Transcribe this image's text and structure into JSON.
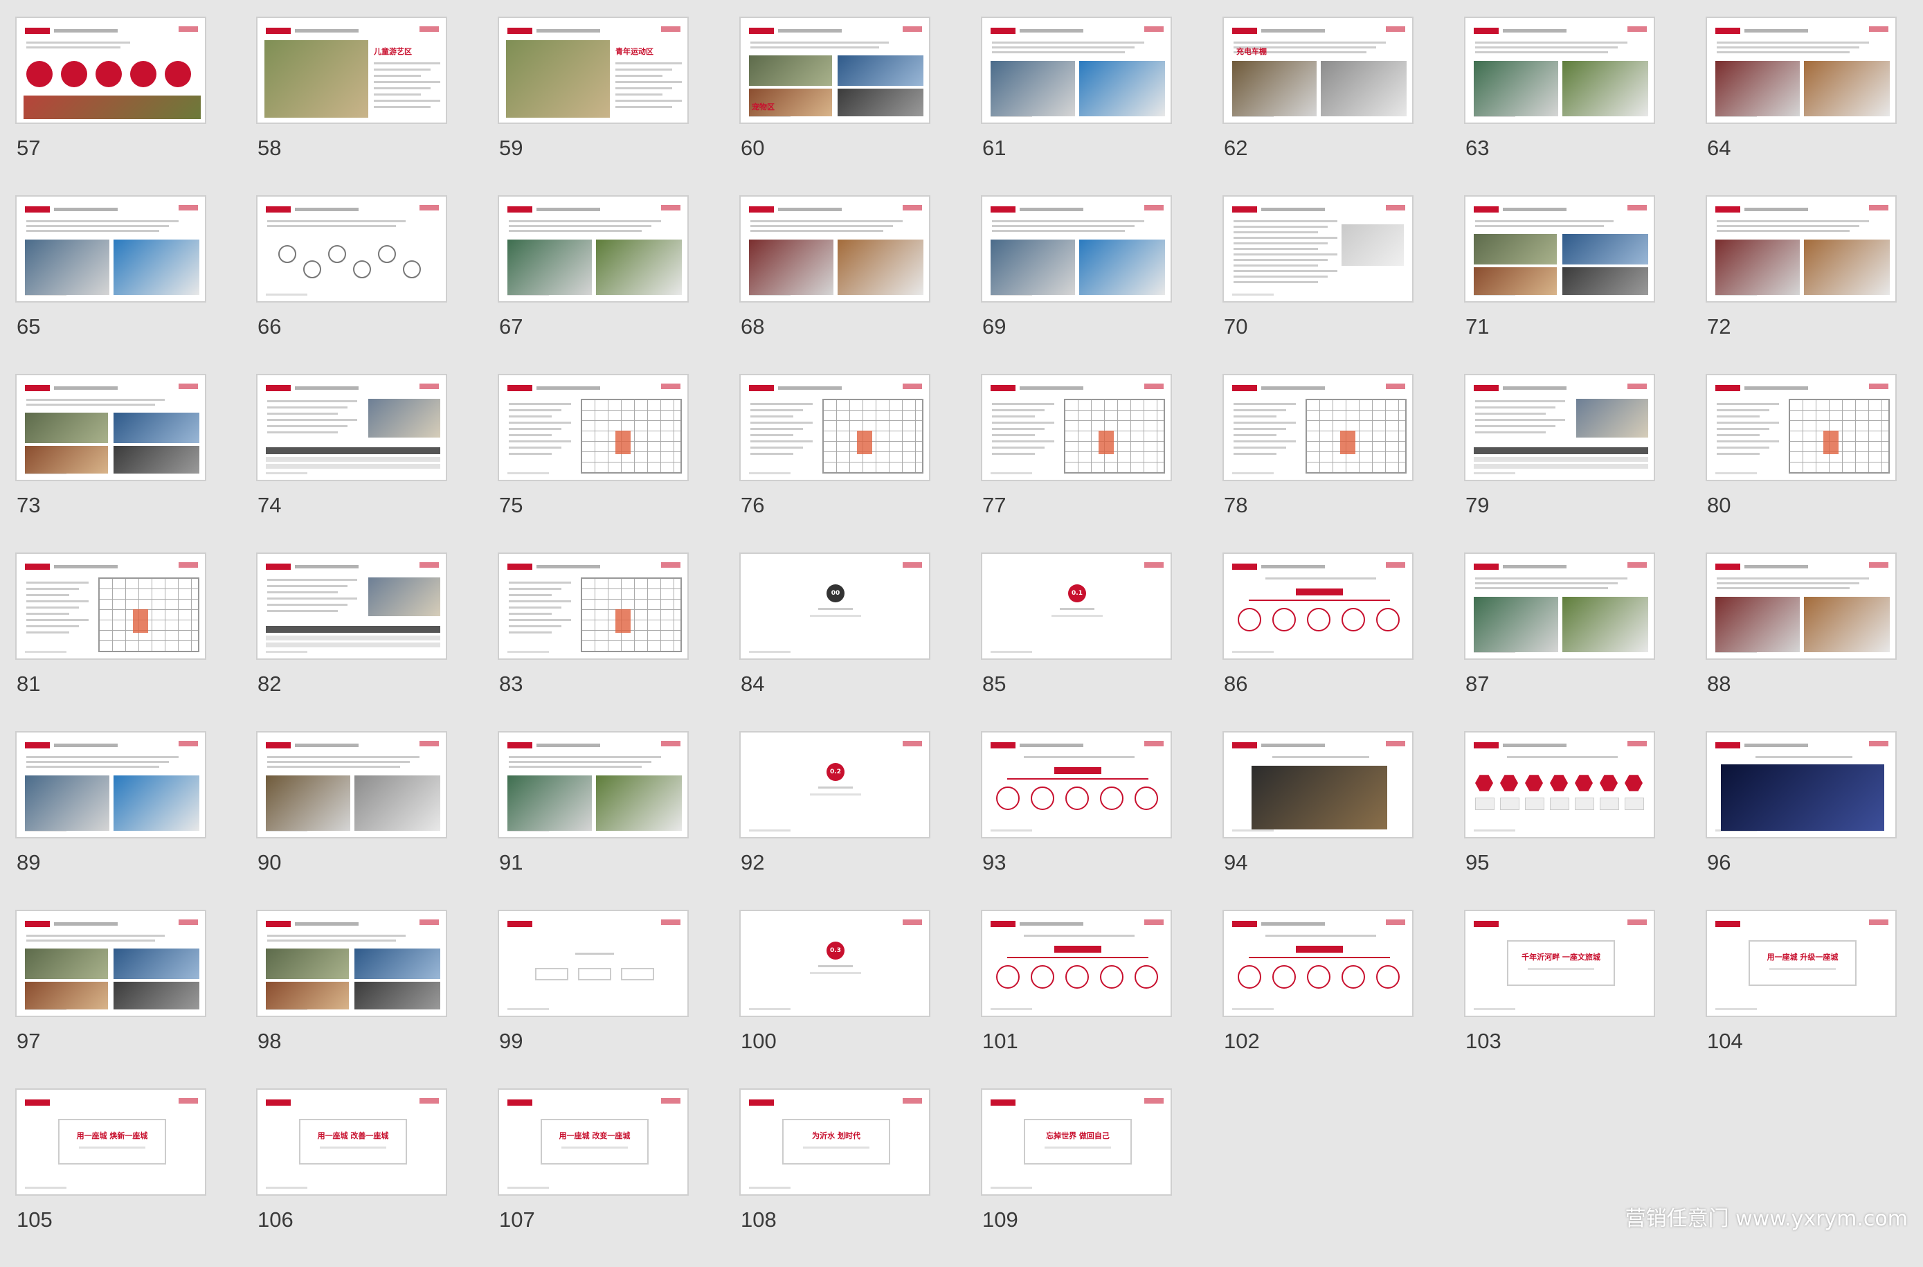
{
  "slides": [
    {
      "num": "57",
      "kind": "circles"
    },
    {
      "num": "58",
      "kind": "map",
      "label": "儿童游艺区"
    },
    {
      "num": "59",
      "kind": "map",
      "label": "青年运动区"
    },
    {
      "num": "60",
      "kind": "photos4",
      "label": "宠物区"
    },
    {
      "num": "61",
      "kind": "photos2"
    },
    {
      "num": "62",
      "kind": "photos2",
      "label": "充电车棚"
    },
    {
      "num": "63",
      "kind": "photos2"
    },
    {
      "num": "64",
      "kind": "photos2"
    },
    {
      "num": "65",
      "kind": "photos2"
    },
    {
      "num": "66",
      "kind": "icons"
    },
    {
      "num": "67",
      "kind": "photos2"
    },
    {
      "num": "68",
      "kind": "photos2"
    },
    {
      "num": "69",
      "kind": "photos2"
    },
    {
      "num": "70",
      "kind": "text"
    },
    {
      "num": "71",
      "kind": "photos4"
    },
    {
      "num": "72",
      "kind": "photos2"
    },
    {
      "num": "73",
      "kind": "photos4"
    },
    {
      "num": "74",
      "kind": "table"
    },
    {
      "num": "75",
      "kind": "plan"
    },
    {
      "num": "76",
      "kind": "plan"
    },
    {
      "num": "77",
      "kind": "plan"
    },
    {
      "num": "78",
      "kind": "plan"
    },
    {
      "num": "79",
      "kind": "table"
    },
    {
      "num": "80",
      "kind": "plan"
    },
    {
      "num": "81",
      "kind": "plan"
    },
    {
      "num": "82",
      "kind": "table"
    },
    {
      "num": "83",
      "kind": "plan"
    },
    {
      "num": "84",
      "kind": "section",
      "circle": "00",
      "color": "#333333"
    },
    {
      "num": "85",
      "kind": "section",
      "circle": "0.1",
      "color": "#c8102e"
    },
    {
      "num": "86",
      "kind": "tree"
    },
    {
      "num": "87",
      "kind": "photos2"
    },
    {
      "num": "88",
      "kind": "photos2"
    },
    {
      "num": "89",
      "kind": "photos2"
    },
    {
      "num": "90",
      "kind": "photos2"
    },
    {
      "num": "91",
      "kind": "photos2"
    },
    {
      "num": "92",
      "kind": "section",
      "circle": "0.2",
      "color": "#c8102e"
    },
    {
      "num": "93",
      "kind": "tree"
    },
    {
      "num": "94",
      "kind": "photo1"
    },
    {
      "num": "95",
      "kind": "hexes"
    },
    {
      "num": "96",
      "kind": "photo1dark"
    },
    {
      "num": "97",
      "kind": "photos4"
    },
    {
      "num": "98",
      "kind": "photos4"
    },
    {
      "num": "99",
      "kind": "buttons"
    },
    {
      "num": "100",
      "kind": "section",
      "circle": "0.3",
      "color": "#c8102e"
    },
    {
      "num": "101",
      "kind": "tree"
    },
    {
      "num": "102",
      "kind": "tree"
    },
    {
      "num": "103",
      "kind": "slogan",
      "text": "千年沂河畔 一座文旅城"
    },
    {
      "num": "104",
      "kind": "slogan",
      "text": "用一座城 升级一座城"
    },
    {
      "num": "105",
      "kind": "slogan",
      "text": "用一座城 焕新一座城"
    },
    {
      "num": "106",
      "kind": "slogan",
      "text": "用一座城 改善一座城"
    },
    {
      "num": "107",
      "kind": "slogan",
      "text": "用一座城 改变一座城"
    },
    {
      "num": "108",
      "kind": "slogan",
      "text": "为沂水 划时代"
    },
    {
      "num": "109",
      "kind": "slogan",
      "text": "忘掉世界 做回自己"
    }
  ],
  "watermark": "营销任意门 www.yxrym.com",
  "colors": {
    "accent": "#c8102e",
    "background": "#e6e6e6"
  }
}
